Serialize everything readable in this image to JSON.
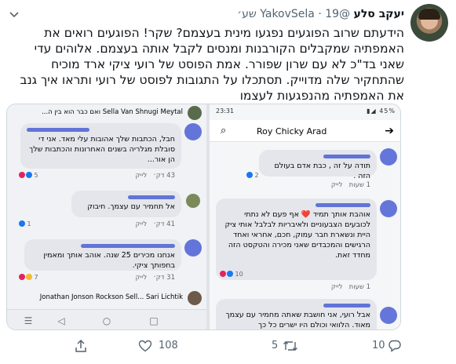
{
  "author": {
    "display_name": "יעקב סלע",
    "handle": "@YakovSela",
    "separator": "·",
    "timestamp": "19 שע׳"
  },
  "tweet": {
    "text": "הידעתם שרוב הפוגעים נפגעו מינית בעצמם? שקר! הפוגעים רואים את האמפתיה שמקבלים הקורבנות ומנסים לקבל אותה בעצמם. אלוהים עדי שאני בד\"כ לא עם שרון שפורר. אמת הפוסט של רועי ציקי ארד מוכיח שהתחקיר שלה מדוייק. תסתכלו על התגובות לפוסט של רועי ותראו איך גנב את האמפתיה מהנפגעות לעצמו"
  },
  "screenshot_left": {
    "top_bar": "Sella Van Shnugi Meytal ואם כבר הוא בין ה...",
    "comments": [
      {
        "text": "חבל, הכתבות שלך אהובות עלי מאד. אני די סובלת מגלריה בשנים האחרונות והכתבות שלך הן אור...",
        "time": "43 דק׳",
        "like": "לייק",
        "reactions": "5"
      },
      {
        "text": "אל תחמיר עם עצמך. חיבוק",
        "time": "41 דק׳",
        "like": "לייק",
        "reactions": "1"
      },
      {
        "text": "אנחנו מכירים 25 שנה. אוהב אותך ומאמין בחפותך ציקי.",
        "time": "31 דק׳",
        "like": "לייק",
        "reactions": "7"
      }
    ],
    "bottom_bar": "Jonathan Jonson Rockson Sell... Sari Lichtik"
  },
  "screenshot_right": {
    "status_time": "23:31",
    "status_icons": "▮◢ 45%",
    "header_title": "Roy Chicky Arad",
    "comments": [
      {
        "text": "תודה על זה , כבת אדם בעולם הזה .",
        "time": "1 שעות",
        "like": "לייק",
        "reactions": "2"
      },
      {
        "text": "אוהבת אותך תמיד ❤️ אף פעם לא נתתי לכובעים הצבעוניים ולאיבריות לבלבל אותי ציק היית ונשארת חבר עמוק, חכם, אחראי ואחד הרגישים והמכבדים שאני מכירה והטקסט הזה מחדד זאת.",
        "time": "1 שעות",
        "like": "לייק",
        "reactions": "10"
      },
      {
        "text": "אבל רועי, אני חושבת שאתה מחמיר עם עצמך מאוד. הלוואי וכולם היו ישרים כל כך",
        "time": "",
        "like": "",
        "reactions": ""
      }
    ]
  },
  "actions": {
    "reply_count": "10",
    "retweet_count": "5",
    "like_count": "108"
  },
  "colors": {
    "icon_gray": "#536471",
    "scribble": "#4a5fd4",
    "bubble": "#e4e6eb"
  }
}
